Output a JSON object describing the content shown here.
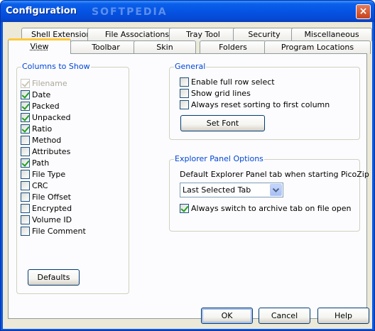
{
  "window": {
    "title": "Configuration",
    "close_glyph": "×",
    "watermark": "SOFTPEDIA"
  },
  "tabs_row_back": [
    {
      "label": "Shell Extensions"
    },
    {
      "label": "File Associations"
    },
    {
      "label": "Tray Tool"
    },
    {
      "label": "Security"
    },
    {
      "label": "Miscellaneous"
    }
  ],
  "tabs_row_front": [
    {
      "label": "View",
      "active": true
    },
    {
      "label": "Toolbar"
    },
    {
      "label": "Skin"
    },
    {
      "label": "Folders"
    },
    {
      "label": "Program Locations"
    }
  ],
  "columns": {
    "label": "Columns to Show",
    "items": [
      {
        "label": "Filename",
        "checked": true,
        "disabled": true
      },
      {
        "label": "Date",
        "checked": true
      },
      {
        "label": "Packed",
        "checked": true
      },
      {
        "label": "Unpacked",
        "checked": true
      },
      {
        "label": "Ratio",
        "checked": true
      },
      {
        "label": "Method",
        "checked": false
      },
      {
        "label": "Attributes",
        "checked": false
      },
      {
        "label": "Path",
        "checked": true
      },
      {
        "label": "File Type",
        "checked": false
      },
      {
        "label": "CRC",
        "checked": false
      },
      {
        "label": "File Offset",
        "checked": false
      },
      {
        "label": "Encrypted",
        "checked": false
      },
      {
        "label": "Volume ID",
        "checked": false
      },
      {
        "label": "File Comment",
        "checked": false
      }
    ],
    "defaults_button": "Defaults"
  },
  "general": {
    "label": "General",
    "options": [
      {
        "label": "Enable full row select",
        "checked": false
      },
      {
        "label": "Show grid lines",
        "checked": false
      },
      {
        "label": "Always reset sorting to first column",
        "checked": false
      }
    ],
    "set_font_button": "Set Font"
  },
  "explorer": {
    "label": "Explorer Panel Options",
    "description": "Default Explorer Panel tab when starting PicoZip",
    "selected_tab": "Last Selected Tab",
    "switch_option": {
      "label": "Always switch to archive tab on file open",
      "checked": true
    }
  },
  "buttons": {
    "ok": "OK",
    "cancel": "Cancel",
    "help": "Help"
  },
  "icons": {
    "close": "close-icon",
    "dropdown": "chevron-down-icon",
    "check": "checkmark-icon"
  }
}
